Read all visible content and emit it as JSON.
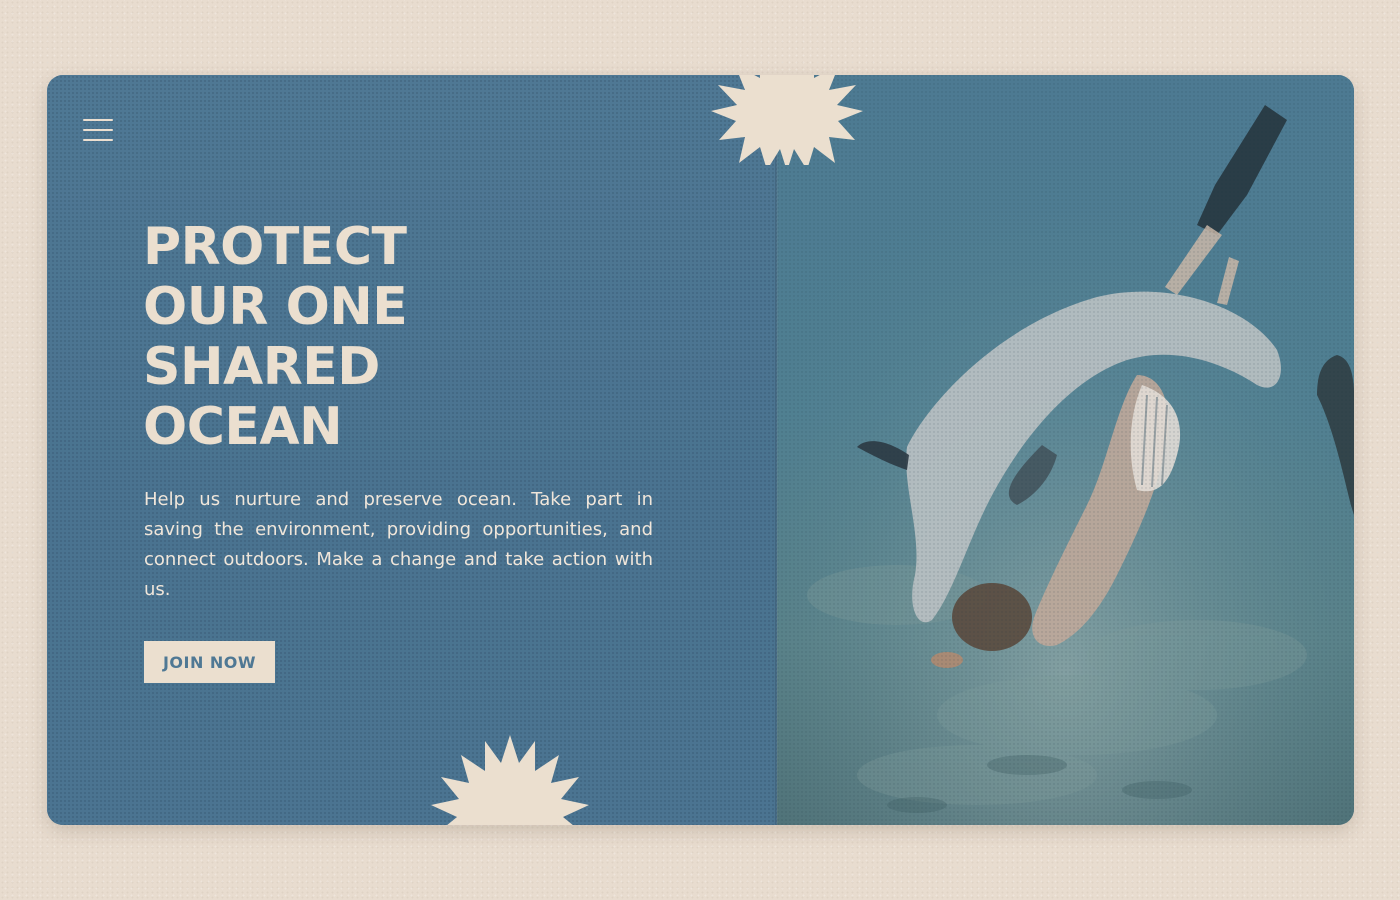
{
  "nav": {
    "menu_icon": "hamburger-menu-icon"
  },
  "hero": {
    "headline_lines": [
      "PROTECT",
      "OUR ONE",
      "SHARED",
      "OCEAN"
    ],
    "body": "Help us nurture and preserve ocean. Take part in saving the environment, providing opportunities, and connect outdoors. Make a change and take action with us.",
    "cta_label": "JOIN NOW"
  },
  "colors": {
    "page_background": "#e8dccf",
    "panel_blue": "#4d7591",
    "cream": "#ebdfcf"
  },
  "decorations": {
    "starburst_icon": "starburst-icon"
  }
}
